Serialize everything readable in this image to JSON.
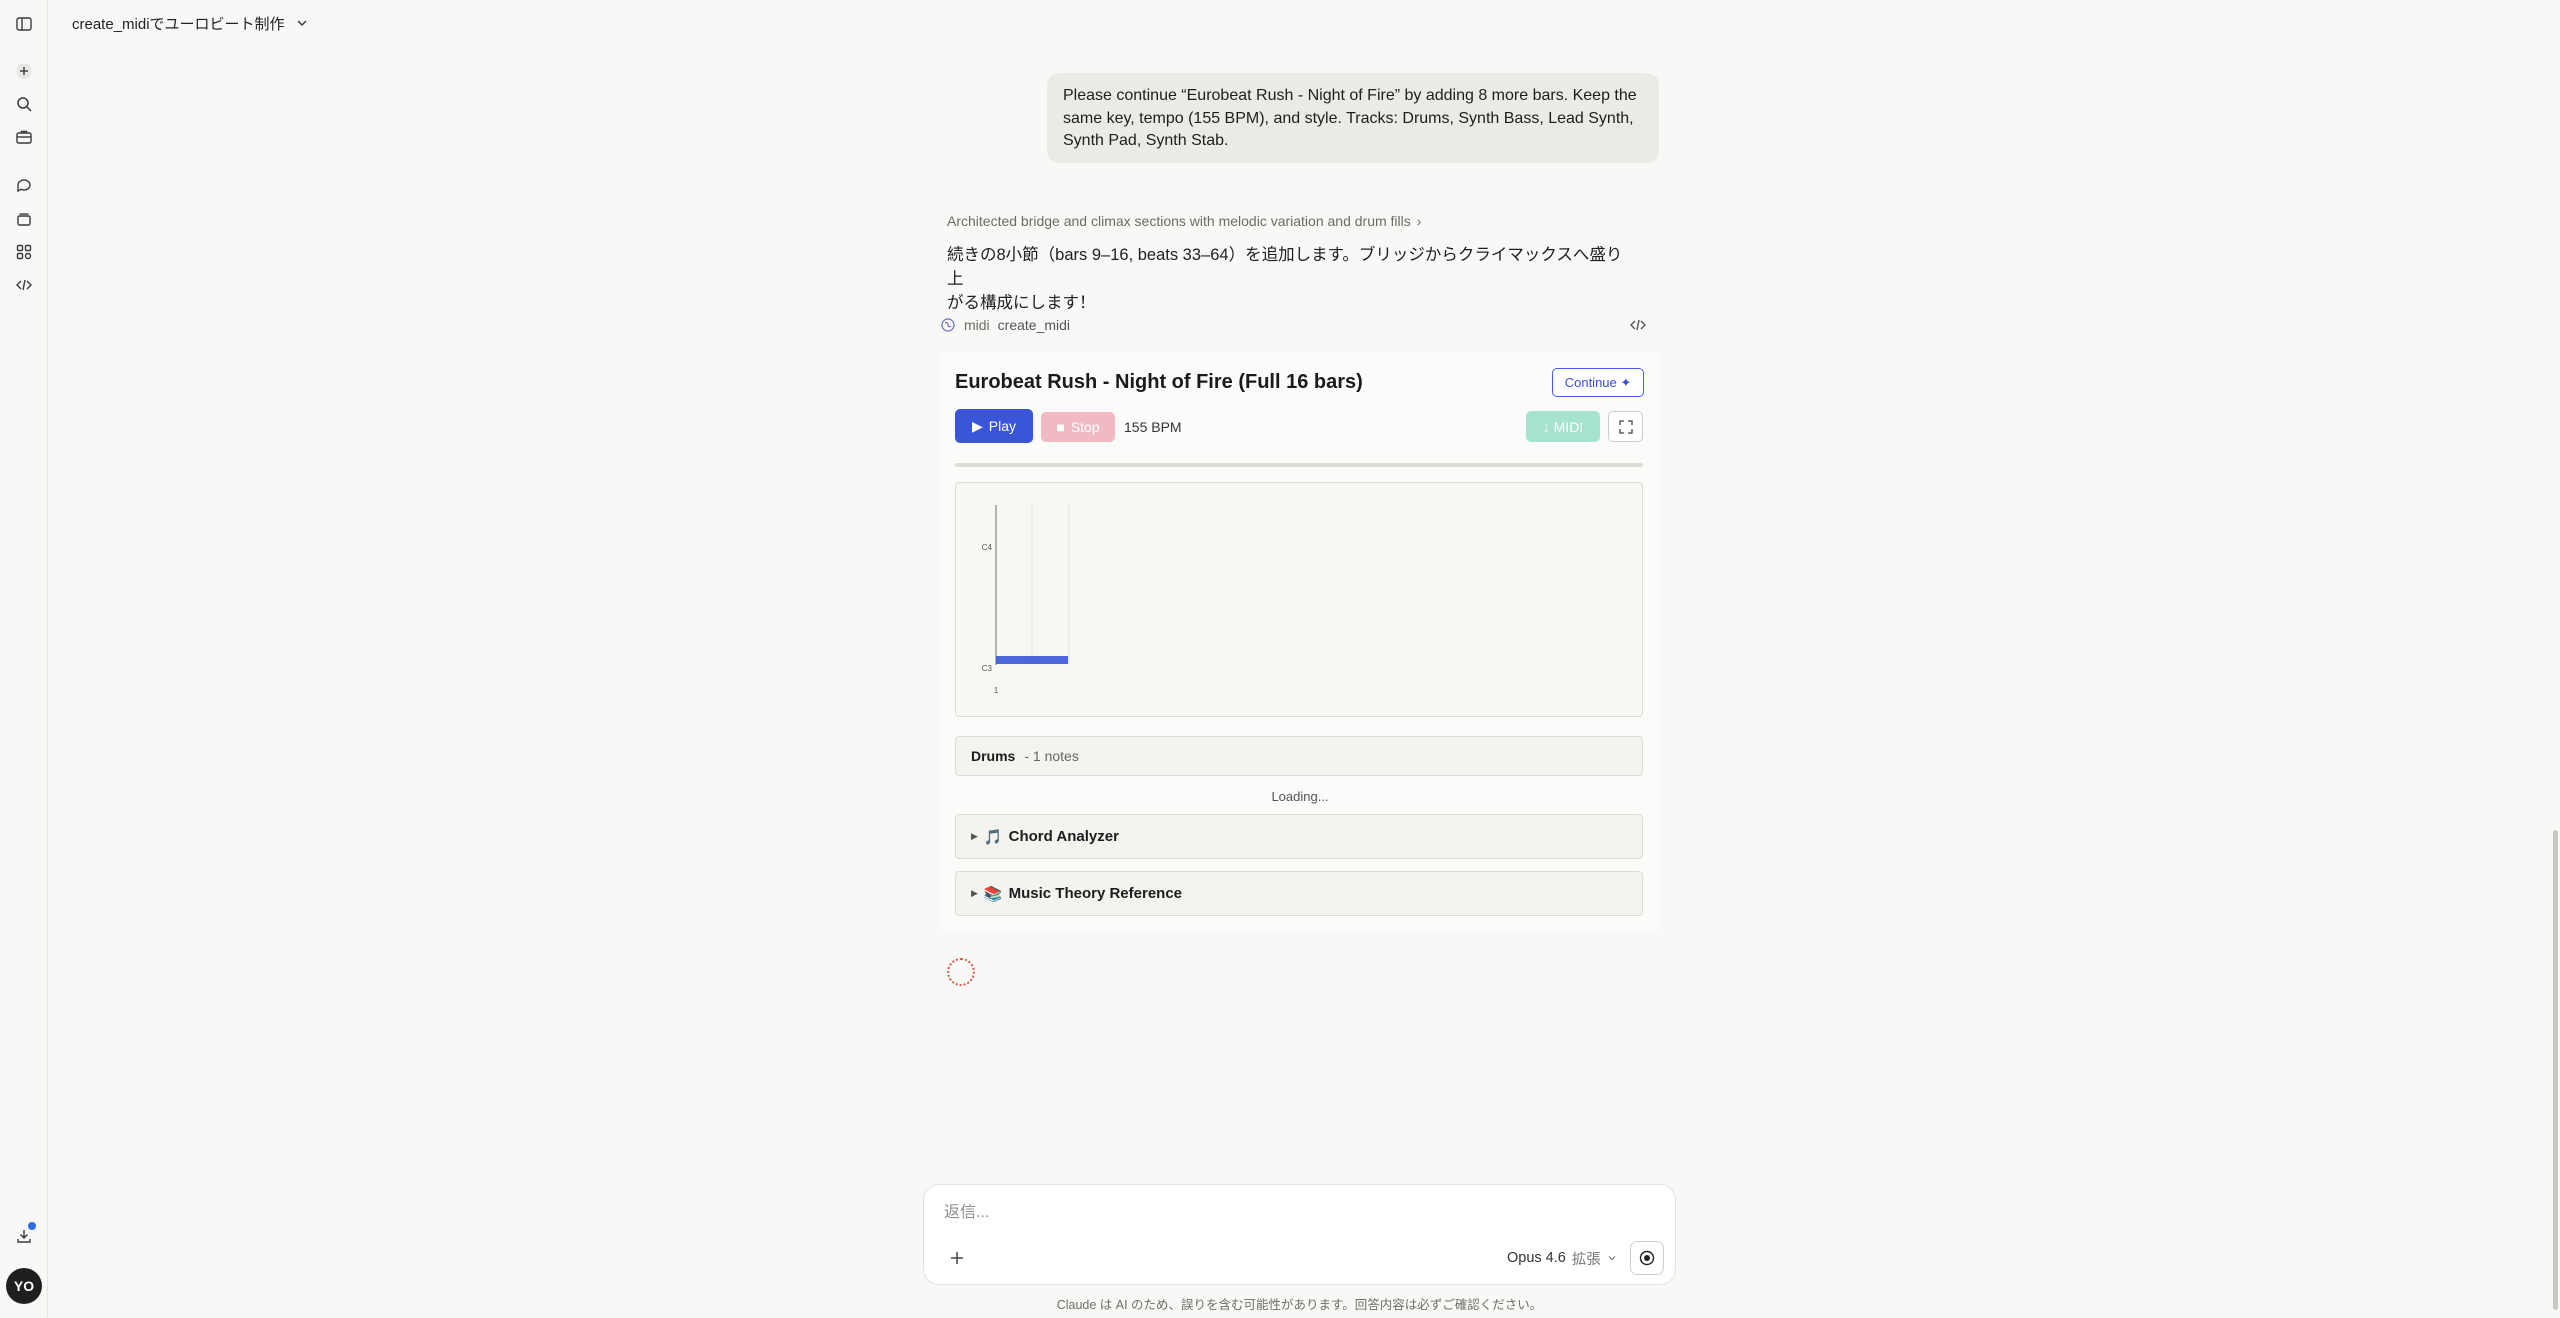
{
  "header": {
    "conversation_title": "create_midiでユーロビート制作"
  },
  "user_message": "Please continue “Eurobeat Rush - Night of Fire” by adding 8 more bars. Keep the same key, tempo (155 BPM), and style. Tracks: Drums, Synth Bass, Lead Synth, Synth Pad, Synth Stab.",
  "assistant": {
    "thinking_summary": "Architected bridge and climax sections with melodic variation and drum fills",
    "reply_line1": "続きの8小節（bars 9–16, beats 33–64）を追加します。ブリッジからクライマックスへ盛り上",
    "reply_line2": "がる構成にします！",
    "tool": {
      "server": "midi",
      "name": "create_midi"
    }
  },
  "midi_card": {
    "title": "Eurobeat Rush - Night of Fire (Full 16 bars)",
    "continue_label": "Continue ✦",
    "play_label": "Play",
    "stop_label": "Stop",
    "tempo_label": "155 BPM",
    "download_label": "↓ MIDI",
    "progress": 0,
    "piano_roll": {
      "pitch_labels": [
        "C4",
        "C3"
      ],
      "beat_labels": [
        "1"
      ],
      "notes": [
        {
          "pitch": "C3",
          "start_beat": 1,
          "length_beats": 2
        }
      ]
    },
    "track": {
      "name": "Drums",
      "count_label": "- 1 notes"
    },
    "loading_text": "Loading...",
    "sections": [
      {
        "icon": "🎵",
        "label": "Chord Analyzer"
      },
      {
        "icon": "📚",
        "label": "Music Theory Reference"
      }
    ]
  },
  "composer": {
    "placeholder": "返信...",
    "model": "Opus 4.6",
    "mode": "拡張"
  },
  "footer": {
    "disclaimer": "Claude は AI のため、誤りを含む可能性があります。回答内容は必ずご確認ください。"
  },
  "user": {
    "initials": "YO"
  },
  "colors": {
    "accent": "#3b55d9",
    "stop": "#f1b9c2",
    "midi": "#a6e3cf"
  }
}
